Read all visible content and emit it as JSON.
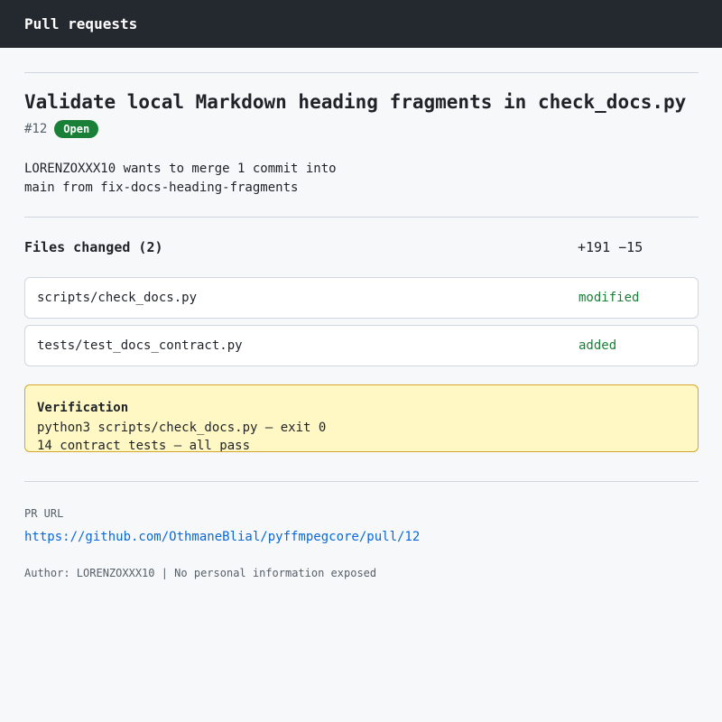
{
  "header": {
    "title": "Pull requests"
  },
  "pr": {
    "title": "Validate local Markdown heading fragments in check_docs.py",
    "number": "#12",
    "status": "Open",
    "merge_line1": "LORENZOXXX10 wants to merge 1 commit into",
    "merge_line2": "main from fix-docs-heading-fragments"
  },
  "files": {
    "title": "Files changed (2)",
    "diffstat": "+191 −15",
    "items": [
      {
        "path": "scripts/check_docs.py",
        "status": "modified"
      },
      {
        "path": "tests/test_docs_contract.py",
        "status": "added"
      }
    ]
  },
  "verification": {
    "title": "Verification",
    "lines": [
      "python3 scripts/check_docs.py — exit 0",
      "14 contract tests — all pass"
    ]
  },
  "footer": {
    "url_label": "PR URL",
    "url": "https://github.com/OthmaneBlial/pyffmpegcore/pull/12",
    "author": "Author: LORENZOXXX10 | No personal information exposed"
  },
  "colors": {
    "topbar": "#24292f",
    "open_badge": "#1a7f37",
    "link": "#0969da",
    "verify_bg": "#fff8c5"
  }
}
